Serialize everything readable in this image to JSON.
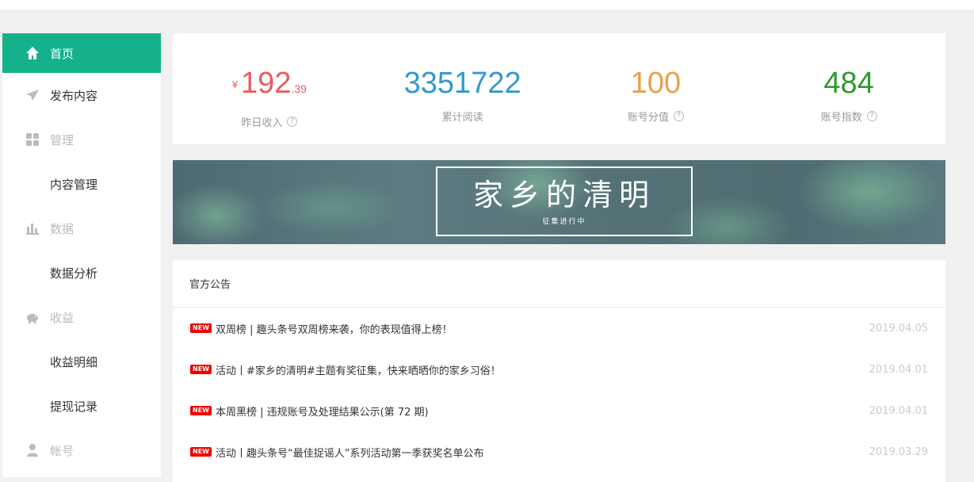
{
  "sidebar": {
    "items": [
      {
        "label": "首页",
        "icon": "home-icon"
      },
      {
        "label": "发布内容",
        "icon": "paper-plane-icon"
      },
      {
        "label": "管理",
        "icon": "grid-icon"
      },
      {
        "label": "内容管理"
      },
      {
        "label": "数据",
        "icon": "bar-chart-icon"
      },
      {
        "label": "数据分析"
      },
      {
        "label": "收益",
        "icon": "piggy-bank-icon"
      },
      {
        "label": "收益明细"
      },
      {
        "label": "提现记录"
      },
      {
        "label": "帐号",
        "icon": "user-icon"
      }
    ]
  },
  "stats": {
    "income": {
      "currency": "¥",
      "integer": "192",
      "decimal": ".39",
      "label": "昨日收入",
      "color": "#e85c5c"
    },
    "reads": {
      "value": "3351722",
      "label": "累计阅读",
      "color": "#3399cc"
    },
    "score": {
      "value": "100",
      "label": "账号分值",
      "color": "#e8a04b"
    },
    "index": {
      "value": "484",
      "label": "账号指数",
      "color": "#2e9a2e"
    }
  },
  "banner": {
    "title": "家乡的清明",
    "subtitle": "征集进行中"
  },
  "notice": {
    "header": "官方公告",
    "badge": "NEW",
    "items": [
      {
        "text": "双周榜 | 趣头条号双周榜来袭，你的表现值得上榜！",
        "date": "2019.04.05"
      },
      {
        "text": "活动丨#家乡的清明#主题有奖征集，快来晒晒你的家乡习俗！",
        "date": "2019.04.01"
      },
      {
        "text": "本周黑榜 | 违规账号及处理结果公示(第 72 期)",
        "date": "2019.04.01"
      },
      {
        "text": "活动丨趣头条号“最佳捉谣人”系列活动第一季获奖名单公布",
        "date": "2019.03.29"
      }
    ]
  },
  "colors": {
    "accent": "#14b18a"
  }
}
